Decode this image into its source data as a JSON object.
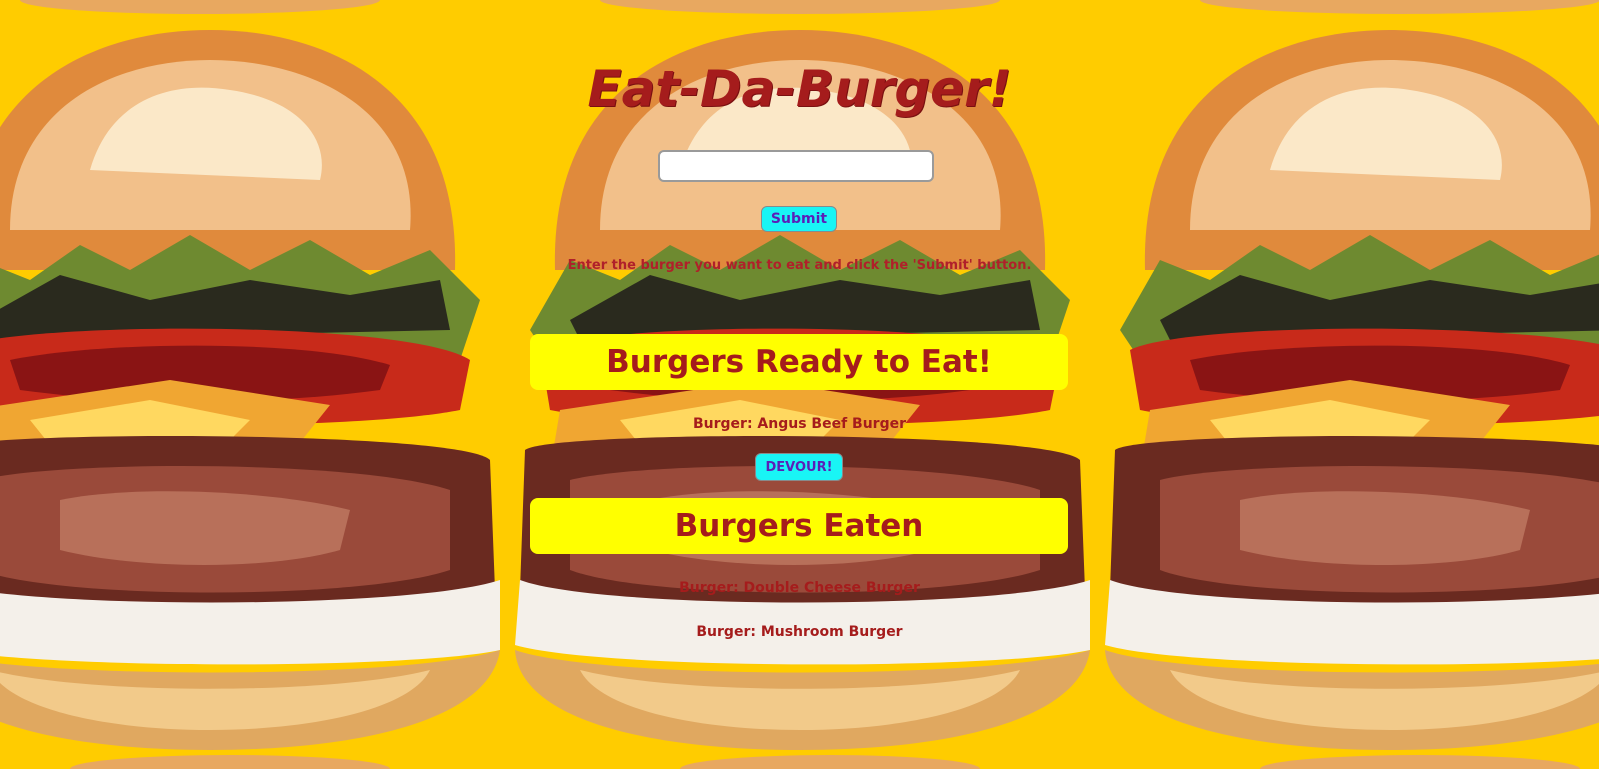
{
  "page": {
    "title": "Eat-Da-Burger!",
    "background_color": "#ffcc00"
  },
  "form": {
    "input_value": "",
    "input_placeholder": "",
    "submit_label": "Submit",
    "instructions": "Enter the burger you want to eat and click the 'Submit' button."
  },
  "ready": {
    "heading": "Burgers Ready to Eat!",
    "items": [
      {
        "text": "Burger: Angus Beef Burger",
        "button_label": "DEVOUR!"
      }
    ]
  },
  "eaten": {
    "heading": "Burgers Eaten",
    "items": [
      {
        "text": "Burger: Double Cheese Burger"
      },
      {
        "text": "Burger: Mushroom Burger"
      }
    ]
  },
  "colors": {
    "heading_red": "#a51c1c",
    "panel_yellow": "#ffff00",
    "button_cyan": "#19f5f5",
    "button_text_purple": "#5b1fb8"
  },
  "icons": {
    "background": "burger-pattern-image"
  }
}
